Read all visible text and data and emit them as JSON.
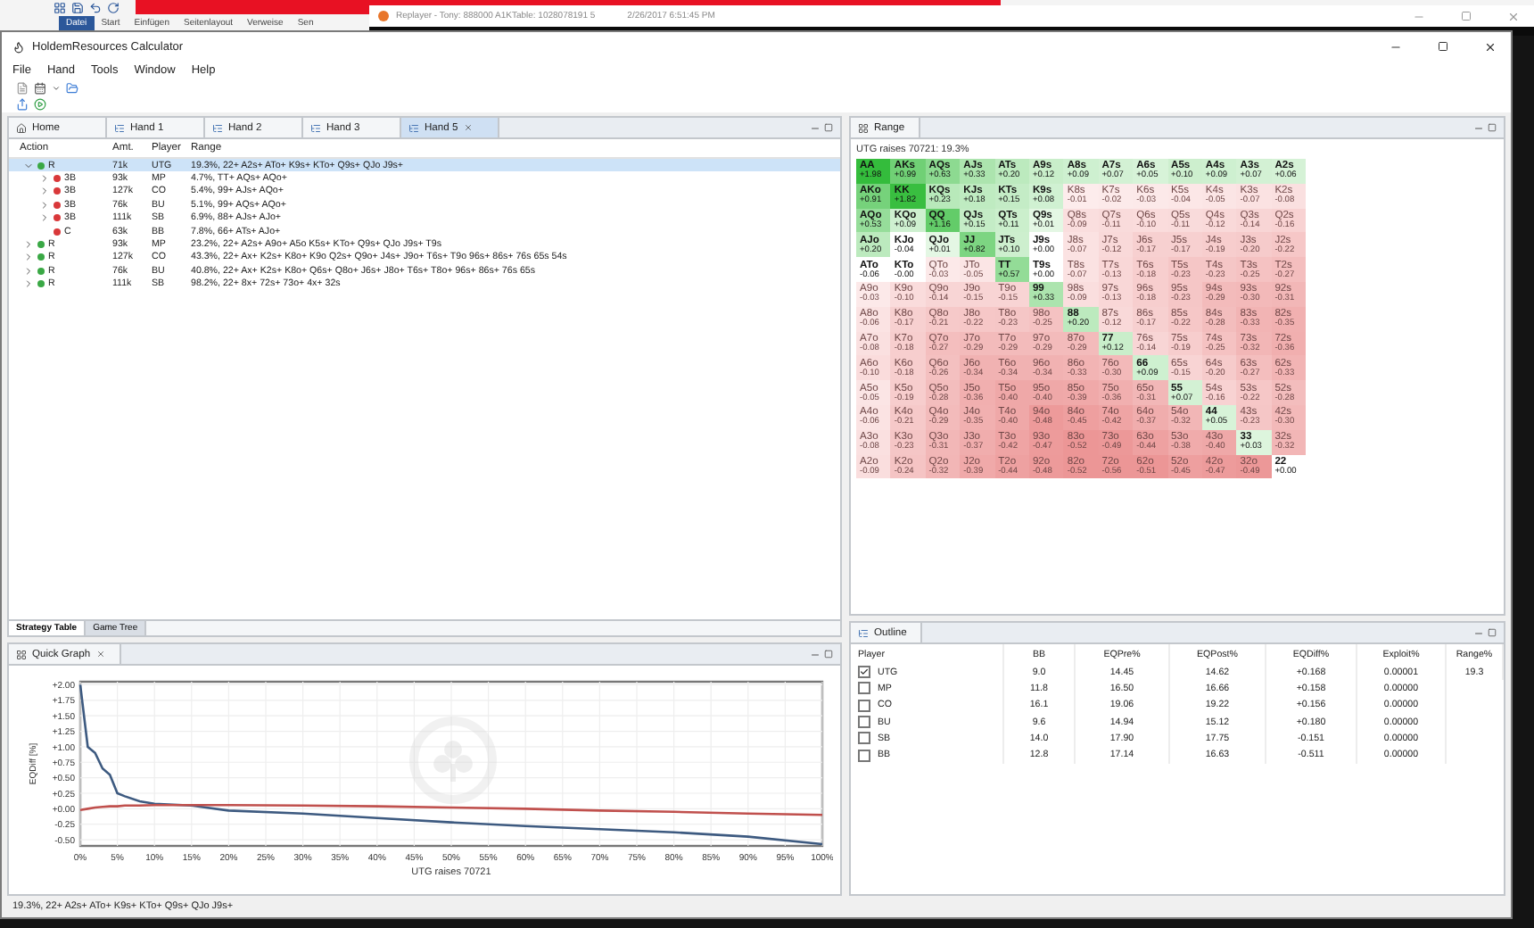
{
  "background": {
    "ribbon_tabs": [
      {
        "label": "Datei",
        "selected": true
      },
      {
        "label": "Start",
        "selected": false
      },
      {
        "label": "Einfügen",
        "selected": false
      },
      {
        "label": "Seitenlayout",
        "selected": false
      },
      {
        "label": "Verweise",
        "selected": false
      },
      {
        "label": "Sen",
        "selected": false
      }
    ],
    "replayer": {
      "title": "Replayer - Tony: 888000 A1KTable: 1028078191 5",
      "time": "2/26/2017 6:51:45 PM"
    }
  },
  "window": {
    "title": "HoldemResources Calculator"
  },
  "menu": [
    "File",
    "Hand",
    "Tools",
    "Window",
    "Help"
  ],
  "hand_tabs": [
    {
      "label": "Home",
      "kind": "home",
      "selected": false
    },
    {
      "label": "Hand 1",
      "kind": "hand",
      "selected": false
    },
    {
      "label": "Hand 2",
      "kind": "hand",
      "selected": false
    },
    {
      "label": "Hand 3",
      "kind": "hand",
      "selected": false
    },
    {
      "label": "Hand 5",
      "kind": "hand",
      "selected": true
    }
  ],
  "tree": {
    "columns": [
      "Action",
      "Amt.",
      "Player",
      "Range"
    ],
    "items": [
      {
        "action": "R",
        "amount": "71k",
        "player": "UTG",
        "range": "19.3%, 22+ A2s+ ATo+ K9s+ KTo+ Q9s+ QJo J9s+",
        "color": "#3aa845",
        "expanded": true,
        "selected": true,
        "children": [
          {
            "action": "3B",
            "amount": "93k",
            "player": "MP",
            "range": "4.7%, TT+ AQs+ AQo+",
            "color": "#d9383a",
            "expanded": false,
            "selected": false
          },
          {
            "action": "3B",
            "amount": "127k",
            "player": "CO",
            "range": "5.4%, 99+ AJs+ AQo+",
            "color": "#d9383a",
            "expanded": false,
            "selected": false
          },
          {
            "action": "3B",
            "amount": "76k",
            "player": "BU",
            "range": "5.1%, 99+ AQs+ AQo+",
            "color": "#d9383a",
            "expanded": false,
            "selected": false
          },
          {
            "action": "3B",
            "amount": "111k",
            "player": "SB",
            "range": "6.9%, 88+ AJs+ AJo+",
            "color": "#d9383a",
            "expanded": false,
            "selected": false
          },
          {
            "action": "C",
            "amount": "63k",
            "player": "BB",
            "range": "7.8%, 66+ ATs+ AJo+",
            "color": "#d9383a",
            "selected": false
          }
        ]
      },
      {
        "action": "R",
        "amount": "93k",
        "player": "MP",
        "range": "23.2%, 22+ A2s+ A9o+ A5o K5s+ KTo+ Q9s+ QJo J9s+ T9s",
        "color": "#3aa845",
        "expanded": false,
        "selected": false
      },
      {
        "action": "R",
        "amount": "127k",
        "player": "CO",
        "range": "43.3%, 22+ Ax+ K2s+ K8o+ K9o Q2s+ Q9o+ J4s+ J9o+ T6s+ T9o 96s+ 86s+ 76s 65s 54s",
        "color": "#3aa845",
        "expanded": false,
        "selected": false
      },
      {
        "action": "R",
        "amount": "76k",
        "player": "BU",
        "range": "40.8%, 22+ Ax+ K2s+ K8o+ Q6s+ Q8o+ J6s+ J8o+ T6s+ T8o+ 96s+ 86s+ 76s 65s",
        "color": "#3aa845",
        "expanded": false,
        "selected": false
      },
      {
        "action": "R",
        "amount": "111k",
        "player": "SB",
        "range": "98.2%, 22+ 8x+ 72s+ 73o+ 4x+ 32s",
        "color": "#3aa845",
        "expanded": false,
        "selected": false
      }
    ]
  },
  "view_tabs": [
    {
      "label": "Strategy Table",
      "selected": true
    },
    {
      "label": "Game Tree",
      "selected": false
    }
  ],
  "quick_graph": {
    "title": "Quick Graph",
    "chart_data": {
      "type": "line",
      "xlabel": "UTG raises 70721",
      "ylabel": "EQDiff [%]",
      "x": [
        0,
        1,
        2,
        3,
        4,
        5,
        6,
        8,
        10,
        15,
        20,
        30,
        40,
        50,
        60,
        70,
        80,
        90,
        100
      ],
      "series": [
        {
          "color": "#3d5a80",
          "values": [
            2.0,
            1.0,
            0.9,
            0.65,
            0.55,
            0.25,
            0.2,
            0.12,
            0.08,
            0.05,
            -0.03,
            -0.08,
            -0.15,
            -0.22,
            -0.28,
            -0.33,
            -0.38,
            -0.45,
            -0.57
          ]
        },
        {
          "color": "#c0504d",
          "values": [
            -0.02,
            0.0,
            0.02,
            0.03,
            0.04,
            0.04,
            0.05,
            0.05,
            0.06,
            0.06,
            0.06,
            0.05,
            0.04,
            0.02,
            0.0,
            -0.03,
            -0.05,
            -0.08,
            -0.1
          ]
        }
      ],
      "xlim": [
        0,
        100
      ],
      "ylim": [
        -0.6,
        2.05
      ],
      "grid": true,
      "xticks": [
        {
          "value": 0,
          "label": "0%"
        },
        {
          "value": 5,
          "label": "5%"
        },
        {
          "value": 10,
          "label": "10%"
        },
        {
          "value": 15,
          "label": "15%"
        },
        {
          "value": 20,
          "label": "20%"
        },
        {
          "value": 25,
          "label": "25%"
        },
        {
          "value": 30,
          "label": "30%"
        },
        {
          "value": 35,
          "label": "35%"
        },
        {
          "value": 40,
          "label": "40%"
        },
        {
          "value": 45,
          "label": "45%"
        },
        {
          "value": 50,
          "label": "50%"
        },
        {
          "value": 55,
          "label": "55%"
        },
        {
          "value": 60,
          "label": "60%"
        },
        {
          "value": 65,
          "label": "65%"
        },
        {
          "value": 70,
          "label": "70%"
        },
        {
          "value": 75,
          "label": "75%"
        },
        {
          "value": 80,
          "label": "80%"
        },
        {
          "value": 85,
          "label": "85%"
        },
        {
          "value": 90,
          "label": "90%"
        },
        {
          "value": 95,
          "label": "95%"
        },
        {
          "value": 100,
          "label": "100%"
        }
      ],
      "yticks": [
        {
          "value": 2,
          "label": "+2.00"
        },
        {
          "value": 1.75,
          "label": "+1.75"
        },
        {
          "value": 1.5,
          "label": "+1.50"
        },
        {
          "value": 1.25,
          "label": "+1.25"
        },
        {
          "value": 1,
          "label": "+1.00"
        },
        {
          "value": 0.75,
          "label": "+0.75"
        },
        {
          "value": 0.5,
          "label": "+0.50"
        },
        {
          "value": 0.25,
          "label": "+0.25"
        },
        {
          "value": 0,
          "label": "+0.00"
        },
        {
          "value": -0.25,
          "label": "-0.25"
        },
        {
          "value": -0.5,
          "label": "-0.50"
        }
      ]
    }
  },
  "status_bar": {
    "text": "19.3%, 22+ A2s+ ATo+ K9s+ KTo+ Q9s+ QJo J9s+"
  },
  "range": {
    "title": "Range",
    "caption": "UTG raises 70721: 19.3%",
    "rows": [
      [
        {
          "hand": "AA",
          "ev": "+1.98",
          "in_range": true
        },
        {
          "hand": "AKs",
          "ev": "+0.99",
          "in_range": true
        },
        {
          "hand": "AQs",
          "ev": "+0.63",
          "in_range": true
        },
        {
          "hand": "AJs",
          "ev": "+0.33",
          "in_range": true
        },
        {
          "hand": "ATs",
          "ev": "+0.20",
          "in_range": true
        },
        {
          "hand": "A9s",
          "ev": "+0.12",
          "in_range": true
        },
        {
          "hand": "A8s",
          "ev": "+0.09",
          "in_range": true
        },
        {
          "hand": "A7s",
          "ev": "+0.07",
          "in_range": true
        },
        {
          "hand": "A6s",
          "ev": "+0.05",
          "in_range": true
        },
        {
          "hand": "A5s",
          "ev": "+0.10",
          "in_range": true
        },
        {
          "hand": "A4s",
          "ev": "+0.09",
          "in_range": true
        },
        {
          "hand": "A3s",
          "ev": "+0.07",
          "in_range": true
        },
        {
          "hand": "A2s",
          "ev": "+0.06",
          "in_range": true
        }
      ],
      [
        {
          "hand": "AKo",
          "ev": "+0.91",
          "in_range": true
        },
        {
          "hand": "KK",
          "ev": "+1.82",
          "in_range": true
        },
        {
          "hand": "KQs",
          "ev": "+0.23",
          "in_range": true
        },
        {
          "hand": "KJs",
          "ev": "+0.18",
          "in_range": true
        },
        {
          "hand": "KTs",
          "ev": "+0.15",
          "in_range": true
        },
        {
          "hand": "K9s",
          "ev": "+0.08",
          "in_range": true
        },
        {
          "hand": "K8s",
          "ev": "-0.01",
          "in_range": false
        },
        {
          "hand": "K7s",
          "ev": "-0.02",
          "in_range": false
        },
        {
          "hand": "K6s",
          "ev": "-0.03",
          "in_range": false
        },
        {
          "hand": "K5s",
          "ev": "-0.04",
          "in_range": false
        },
        {
          "hand": "K4s",
          "ev": "-0.05",
          "in_range": false
        },
        {
          "hand": "K3s",
          "ev": "-0.07",
          "in_range": false
        },
        {
          "hand": "K2s",
          "ev": "-0.08",
          "in_range": false
        }
      ],
      [
        {
          "hand": "AQo",
          "ev": "+0.53",
          "in_range": true
        },
        {
          "hand": "KQo",
          "ev": "+0.09",
          "in_range": true
        },
        {
          "hand": "QQ",
          "ev": "+1.16",
          "in_range": true
        },
        {
          "hand": "QJs",
          "ev": "+0.15",
          "in_range": true
        },
        {
          "hand": "QTs",
          "ev": "+0.11",
          "in_range": true
        },
        {
          "hand": "Q9s",
          "ev": "+0.01",
          "in_range": true
        },
        {
          "hand": "Q8s",
          "ev": "-0.09",
          "in_range": false
        },
        {
          "hand": "Q7s",
          "ev": "-0.11",
          "in_range": false
        },
        {
          "hand": "Q6s",
          "ev": "-0.10",
          "in_range": false
        },
        {
          "hand": "Q5s",
          "ev": "-0.11",
          "in_range": false
        },
        {
          "hand": "Q4s",
          "ev": "-0.12",
          "in_range": false
        },
        {
          "hand": "Q3s",
          "ev": "-0.14",
          "in_range": false
        },
        {
          "hand": "Q2s",
          "ev": "-0.16",
          "in_range": false
        }
      ],
      [
        {
          "hand": "AJo",
          "ev": "+0.20",
          "in_range": true
        },
        {
          "hand": "KJo",
          "ev": "-0.04",
          "in_range": true
        },
        {
          "hand": "QJo",
          "ev": "+0.01",
          "in_range": true
        },
        {
          "hand": "JJ",
          "ev": "+0.82",
          "in_range": true
        },
        {
          "hand": "JTs",
          "ev": "+0.10",
          "in_range": true
        },
        {
          "hand": "J9s",
          "ev": "+0.00",
          "in_range": true
        },
        {
          "hand": "J8s",
          "ev": "-0.07",
          "in_range": false
        },
        {
          "hand": "J7s",
          "ev": "-0.12",
          "in_range": false
        },
        {
          "hand": "J6s",
          "ev": "-0.17",
          "in_range": false
        },
        {
          "hand": "J5s",
          "ev": "-0.17",
          "in_range": false
        },
        {
          "hand": "J4s",
          "ev": "-0.19",
          "in_range": false
        },
        {
          "hand": "J3s",
          "ev": "-0.20",
          "in_range": false
        },
        {
          "hand": "J2s",
          "ev": "-0.22",
          "in_range": false
        }
      ],
      [
        {
          "hand": "ATo",
          "ev": "-0.06",
          "in_range": true
        },
        {
          "hand": "KTo",
          "ev": "-0.00",
          "in_range": true
        },
        {
          "hand": "QTo",
          "ev": "-0.03",
          "in_range": false
        },
        {
          "hand": "JTo",
          "ev": "-0.05",
          "in_range": false
        },
        {
          "hand": "TT",
          "ev": "+0.57",
          "in_range": true
        },
        {
          "hand": "T9s",
          "ev": "+0.00",
          "in_range": true
        },
        {
          "hand": "T8s",
          "ev": "-0.07",
          "in_range": false
        },
        {
          "hand": "T7s",
          "ev": "-0.13",
          "in_range": false
        },
        {
          "hand": "T6s",
          "ev": "-0.18",
          "in_range": false
        },
        {
          "hand": "T5s",
          "ev": "-0.23",
          "in_range": false
        },
        {
          "hand": "T4s",
          "ev": "-0.23",
          "in_range": false
        },
        {
          "hand": "T3s",
          "ev": "-0.25",
          "in_range": false
        },
        {
          "hand": "T2s",
          "ev": "-0.27",
          "in_range": false
        }
      ],
      [
        {
          "hand": "A9o",
          "ev": "-0.03",
          "in_range": false
        },
        {
          "hand": "K9o",
          "ev": "-0.10",
          "in_range": false
        },
        {
          "hand": "Q9o",
          "ev": "-0.14",
          "in_range": false
        },
        {
          "hand": "J9o",
          "ev": "-0.15",
          "in_range": false
        },
        {
          "hand": "T9o",
          "ev": "-0.15",
          "in_range": false
        },
        {
          "hand": "99",
          "ev": "+0.33",
          "in_range": true
        },
        {
          "hand": "98s",
          "ev": "-0.09",
          "in_range": false
        },
        {
          "hand": "97s",
          "ev": "-0.13",
          "in_range": false
        },
        {
          "hand": "96s",
          "ev": "-0.18",
          "in_range": false
        },
        {
          "hand": "95s",
          "ev": "-0.23",
          "in_range": false
        },
        {
          "hand": "94s",
          "ev": "-0.29",
          "in_range": false
        },
        {
          "hand": "93s",
          "ev": "-0.30",
          "in_range": false
        },
        {
          "hand": "92s",
          "ev": "-0.31",
          "in_range": false
        }
      ],
      [
        {
          "hand": "A8o",
          "ev": "-0.06",
          "in_range": false
        },
        {
          "hand": "K8o",
          "ev": "-0.17",
          "in_range": false
        },
        {
          "hand": "Q8o",
          "ev": "-0.21",
          "in_range": false
        },
        {
          "hand": "J8o",
          "ev": "-0.22",
          "in_range": false
        },
        {
          "hand": "T8o",
          "ev": "-0.23",
          "in_range": false
        },
        {
          "hand": "98o",
          "ev": "-0.25",
          "in_range": false
        },
        {
          "hand": "88",
          "ev": "+0.20",
          "in_range": true
        },
        {
          "hand": "87s",
          "ev": "-0.12",
          "in_range": false
        },
        {
          "hand": "86s",
          "ev": "-0.17",
          "in_range": false
        },
        {
          "hand": "85s",
          "ev": "-0.22",
          "in_range": false
        },
        {
          "hand": "84s",
          "ev": "-0.28",
          "in_range": false
        },
        {
          "hand": "83s",
          "ev": "-0.33",
          "in_range": false
        },
        {
          "hand": "82s",
          "ev": "-0.35",
          "in_range": false
        }
      ],
      [
        {
          "hand": "A7o",
          "ev": "-0.08",
          "in_range": false
        },
        {
          "hand": "K7o",
          "ev": "-0.18",
          "in_range": false
        },
        {
          "hand": "Q7o",
          "ev": "-0.27",
          "in_range": false
        },
        {
          "hand": "J7o",
          "ev": "-0.29",
          "in_range": false
        },
        {
          "hand": "T7o",
          "ev": "-0.29",
          "in_range": false
        },
        {
          "hand": "97o",
          "ev": "-0.29",
          "in_range": false
        },
        {
          "hand": "87o",
          "ev": "-0.29",
          "in_range": false
        },
        {
          "hand": "77",
          "ev": "+0.12",
          "in_range": true
        },
        {
          "hand": "76s",
          "ev": "-0.14",
          "in_range": false
        },
        {
          "hand": "75s",
          "ev": "-0.19",
          "in_range": false
        },
        {
          "hand": "74s",
          "ev": "-0.25",
          "in_range": false
        },
        {
          "hand": "73s",
          "ev": "-0.32",
          "in_range": false
        },
        {
          "hand": "72s",
          "ev": "-0.36",
          "in_range": false
        }
      ],
      [
        {
          "hand": "A6o",
          "ev": "-0.10",
          "in_range": false
        },
        {
          "hand": "K6o",
          "ev": "-0.18",
          "in_range": false
        },
        {
          "hand": "Q6o",
          "ev": "-0.26",
          "in_range": false
        },
        {
          "hand": "J6o",
          "ev": "-0.34",
          "in_range": false
        },
        {
          "hand": "T6o",
          "ev": "-0.34",
          "in_range": false
        },
        {
          "hand": "96o",
          "ev": "-0.34",
          "in_range": false
        },
        {
          "hand": "86o",
          "ev": "-0.33",
          "in_range": false
        },
        {
          "hand": "76o",
          "ev": "-0.30",
          "in_range": false
        },
        {
          "hand": "66",
          "ev": "+0.09",
          "in_range": true
        },
        {
          "hand": "65s",
          "ev": "-0.15",
          "in_range": false
        },
        {
          "hand": "64s",
          "ev": "-0.20",
          "in_range": false
        },
        {
          "hand": "63s",
          "ev": "-0.27",
          "in_range": false
        },
        {
          "hand": "62s",
          "ev": "-0.33",
          "in_range": false
        }
      ],
      [
        {
          "hand": "A5o",
          "ev": "-0.05",
          "in_range": false
        },
        {
          "hand": "K5o",
          "ev": "-0.19",
          "in_range": false
        },
        {
          "hand": "Q5o",
          "ev": "-0.28",
          "in_range": false
        },
        {
          "hand": "J5o",
          "ev": "-0.36",
          "in_range": false
        },
        {
          "hand": "T5o",
          "ev": "-0.40",
          "in_range": false
        },
        {
          "hand": "95o",
          "ev": "-0.40",
          "in_range": false
        },
        {
          "hand": "85o",
          "ev": "-0.39",
          "in_range": false
        },
        {
          "hand": "75o",
          "ev": "-0.36",
          "in_range": false
        },
        {
          "hand": "65o",
          "ev": "-0.31",
          "in_range": false
        },
        {
          "hand": "55",
          "ev": "+0.07",
          "in_range": true
        },
        {
          "hand": "54s",
          "ev": "-0.16",
          "in_range": false
        },
        {
          "hand": "53s",
          "ev": "-0.22",
          "in_range": false
        },
        {
          "hand": "52s",
          "ev": "-0.28",
          "in_range": false
        }
      ],
      [
        {
          "hand": "A4o",
          "ev": "-0.06",
          "in_range": false
        },
        {
          "hand": "K4o",
          "ev": "-0.21",
          "in_range": false
        },
        {
          "hand": "Q4o",
          "ev": "-0.29",
          "in_range": false
        },
        {
          "hand": "J4o",
          "ev": "-0.35",
          "in_range": false
        },
        {
          "hand": "T4o",
          "ev": "-0.40",
          "in_range": false
        },
        {
          "hand": "94o",
          "ev": "-0.48",
          "in_range": false
        },
        {
          "hand": "84o",
          "ev": "-0.45",
          "in_range": false
        },
        {
          "hand": "74o",
          "ev": "-0.42",
          "in_range": false
        },
        {
          "hand": "64o",
          "ev": "-0.37",
          "in_range": false
        },
        {
          "hand": "54o",
          "ev": "-0.32",
          "in_range": false
        },
        {
          "hand": "44",
          "ev": "+0.05",
          "in_range": true
        },
        {
          "hand": "43s",
          "ev": "-0.23",
          "in_range": false
        },
        {
          "hand": "42s",
          "ev": "-0.30",
          "in_range": false
        }
      ],
      [
        {
          "hand": "A3o",
          "ev": "-0.08",
          "in_range": false
        },
        {
          "hand": "K3o",
          "ev": "-0.23",
          "in_range": false
        },
        {
          "hand": "Q3o",
          "ev": "-0.31",
          "in_range": false
        },
        {
          "hand": "J3o",
          "ev": "-0.37",
          "in_range": false
        },
        {
          "hand": "T3o",
          "ev": "-0.42",
          "in_range": false
        },
        {
          "hand": "93o",
          "ev": "-0.47",
          "in_range": false
        },
        {
          "hand": "83o",
          "ev": "-0.52",
          "in_range": false
        },
        {
          "hand": "73o",
          "ev": "-0.49",
          "in_range": false
        },
        {
          "hand": "63o",
          "ev": "-0.44",
          "in_range": false
        },
        {
          "hand": "53o",
          "ev": "-0.38",
          "in_range": false
        },
        {
          "hand": "43o",
          "ev": "-0.40",
          "in_range": false
        },
        {
          "hand": "33",
          "ev": "+0.03",
          "in_range": true
        },
        {
          "hand": "32s",
          "ev": "-0.32",
          "in_range": false
        }
      ],
      [
        {
          "hand": "A2o",
          "ev": "-0.09",
          "in_range": false
        },
        {
          "hand": "K2o",
          "ev": "-0.24",
          "in_range": false
        },
        {
          "hand": "Q2o",
          "ev": "-0.32",
          "in_range": false
        },
        {
          "hand": "J2o",
          "ev": "-0.39",
          "in_range": false
        },
        {
          "hand": "T2o",
          "ev": "-0.44",
          "in_range": false
        },
        {
          "hand": "92o",
          "ev": "-0.48",
          "in_range": false
        },
        {
          "hand": "82o",
          "ev": "-0.52",
          "in_range": false
        },
        {
          "hand": "72o",
          "ev": "-0.56",
          "in_range": false
        },
        {
          "hand": "62o",
          "ev": "-0.51",
          "in_range": false
        },
        {
          "hand": "52o",
          "ev": "-0.45",
          "in_range": false
        },
        {
          "hand": "42o",
          "ev": "-0.47",
          "in_range": false
        },
        {
          "hand": "32o",
          "ev": "-0.49",
          "in_range": false
        },
        {
          "hand": "22",
          "ev": "+0.00",
          "in_range": true
        }
      ]
    ]
  },
  "outline": {
    "title": "Outline",
    "columns": [
      "Player",
      "BB",
      "EQPre%",
      "EQPost%",
      "EQDiff%",
      "Exploit%",
      "Range%"
    ],
    "rows": [
      {
        "player": "UTG",
        "checked": true,
        "bb": "9.0",
        "eq_pre": "14.45",
        "eq_post": "14.62",
        "eq_diff": "+0.168",
        "exploit": "0.00001",
        "range": "19.3"
      },
      {
        "player": "MP",
        "checked": false,
        "bb": "11.8",
        "eq_pre": "16.50",
        "eq_post": "16.66",
        "eq_diff": "+0.158",
        "exploit": "0.00000"
      },
      {
        "player": "CO",
        "checked": false,
        "bb": "16.1",
        "eq_pre": "19.06",
        "eq_post": "19.22",
        "eq_diff": "+0.156",
        "exploit": "0.00000"
      },
      {
        "player": "BU",
        "checked": false,
        "bb": "9.6",
        "eq_pre": "14.94",
        "eq_post": "15.12",
        "eq_diff": "+0.180",
        "exploit": "0.00000"
      },
      {
        "player": "SB",
        "checked": false,
        "bb": "14.0",
        "eq_pre": "17.90",
        "eq_post": "17.75",
        "eq_diff": "-0.151",
        "exploit": "0.00000"
      },
      {
        "player": "BB",
        "checked": false,
        "bb": "12.8",
        "eq_pre": "17.14",
        "eq_post": "16.63",
        "eq_diff": "-0.511",
        "exploit": "0.00000"
      }
    ]
  }
}
